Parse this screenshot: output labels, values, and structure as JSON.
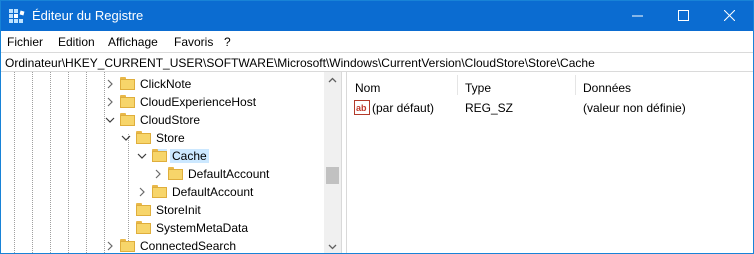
{
  "window": {
    "title": "Éditeur du Registre",
    "title_bar_color": "#0b6cd1"
  },
  "menu": [
    {
      "label": "Fichier"
    },
    {
      "label": "Edition"
    },
    {
      "label": "Affichage"
    },
    {
      "label": "Favoris"
    },
    {
      "label": "?"
    }
  ],
  "address": "Ordinateur\\HKEY_CURRENT_USER\\SOFTWARE\\Microsoft\\Windows\\CurrentVersion\\CloudStore\\Store\\Cache",
  "tree": {
    "nodes": [
      {
        "label": "ClickNote",
        "expander": "collapsed"
      },
      {
        "label": "CloudExperienceHost",
        "expander": "collapsed"
      },
      {
        "label": "CloudStore",
        "expander": "expanded"
      },
      {
        "label": "Store",
        "expander": "expanded"
      },
      {
        "label": "Cache",
        "expander": "expanded",
        "selected": true
      },
      {
        "label": "DefaultAccount",
        "expander": "collapsed"
      },
      {
        "label": "DefaultAccount",
        "expander": "collapsed"
      },
      {
        "label": "StoreInit",
        "expander": "none"
      },
      {
        "label": "SystemMetaData",
        "expander": "none"
      },
      {
        "label": "ConnectedSearch",
        "expander": "collapsed"
      }
    ]
  },
  "list": {
    "columns": [
      "Nom",
      "Type",
      "Données"
    ],
    "rows": [
      {
        "name": "(par défaut)",
        "type": "REG_SZ",
        "data": "(valeur non définie)",
        "icon": "string-value-icon"
      }
    ]
  },
  "colors": {
    "selection": "#cce8ff",
    "folder": "#f7d56a"
  }
}
